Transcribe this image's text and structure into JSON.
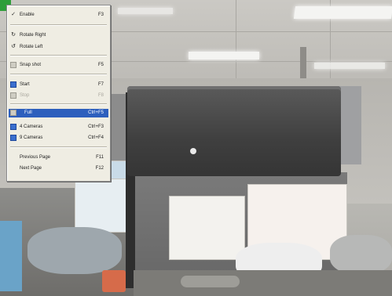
{
  "context_menu": {
    "items": [
      {
        "label": "Enable",
        "shortcut": "F3",
        "icon": "checkmark-icon",
        "state": "checked"
      },
      {
        "label": "Rotate Right",
        "shortcut": "",
        "icon": "rotate-right-icon",
        "state": "normal"
      },
      {
        "label": "Rotate Left",
        "shortcut": "",
        "icon": "rotate-left-icon",
        "state": "normal"
      },
      {
        "label": "Snap shot",
        "shortcut": "F5",
        "icon": "snapshot-icon",
        "state": "normal"
      },
      {
        "label": "Start",
        "shortcut": "F7",
        "icon": "start-icon",
        "state": "normal"
      },
      {
        "label": "Stop",
        "shortcut": "F8",
        "icon": "stop-icon",
        "state": "disabled"
      },
      {
        "label": "Full",
        "shortcut": "Ctrl+F5",
        "icon": "full-view-icon",
        "state": "selected"
      },
      {
        "label": "4 Cameras",
        "shortcut": "Ctrl+F3",
        "icon": "four-cameras-icon",
        "state": "normal"
      },
      {
        "label": "9 Cameras",
        "shortcut": "Ctrl+F4",
        "icon": "nine-cameras-icon",
        "state": "normal"
      },
      {
        "label": "Previous Page",
        "shortcut": "F11",
        "icon": "",
        "state": "normal"
      },
      {
        "label": "Next Page",
        "shortcut": "F12",
        "icon": "",
        "state": "normal"
      }
    ]
  },
  "colors": {
    "menu_background": "#efede3",
    "selection": "#2d5fbd",
    "disabled_text": "#a9a79e"
  }
}
